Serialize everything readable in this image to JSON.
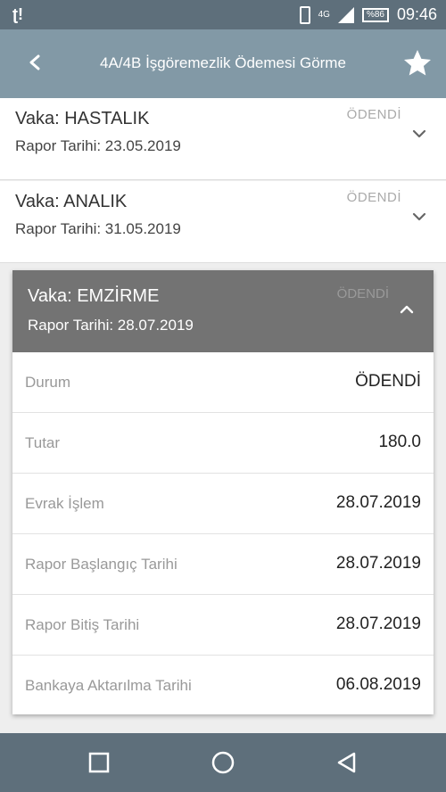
{
  "status_bar": {
    "left_icon": "ʈ!",
    "network": "4G",
    "battery": "%86",
    "time": "09:46"
  },
  "header": {
    "title": "4A/4B İşgöremezlik Ödemesi Görme"
  },
  "cases": [
    {
      "vaka": "Vaka: HASTALIK",
      "rapor_tarihi": "Rapor Tarihi: 23.05.2019",
      "status": "ÖDENDİ"
    },
    {
      "vaka": "Vaka: ANALIK",
      "rapor_tarihi": "Rapor Tarihi: 31.05.2019",
      "status": "ÖDENDİ"
    }
  ],
  "expanded_case": {
    "vaka": "Vaka: EMZİRME",
    "rapor_tarihi": "Rapor Tarihi: 28.07.2019",
    "status": "ÖDENDİ",
    "details": [
      {
        "label": "Durum",
        "value": "ÖDENDİ"
      },
      {
        "label": "Tutar",
        "value": "180.0"
      },
      {
        "label": "Evrak İşlem",
        "value": "28.07.2019"
      },
      {
        "label": "Rapor Başlangıç Tarihi",
        "value": "28.07.2019"
      },
      {
        "label": "Rapor Bitiş Tarihi",
        "value": "28.07.2019"
      },
      {
        "label": "Bankaya Aktarılma Tarihi",
        "value": "06.08.2019"
      }
    ]
  },
  "icons": {
    "back": "back-arrow-icon",
    "favorite": "star-icon",
    "expand": "chevron-down-icon",
    "collapse": "chevron-up-icon",
    "nav_recent": "square-icon",
    "nav_home": "circle-icon",
    "nav_back": "triangle-back-icon"
  }
}
